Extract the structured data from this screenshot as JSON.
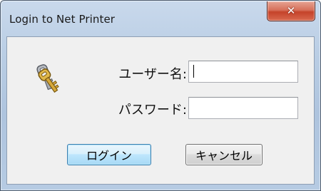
{
  "window": {
    "title": "Login to Net Printer",
    "close_icon": "close-icon"
  },
  "form": {
    "icon": "keys-icon",
    "username_label": "ユーザー名:",
    "username_value": "",
    "password_label": "パスワード:",
    "password_value": ""
  },
  "buttons": {
    "login_label": "ログイン",
    "cancel_label": "キャンセル"
  },
  "colors": {
    "titlebar": "#b9cde4",
    "close_button": "#c5432a",
    "dialog_body": "#f0f0f0",
    "default_button_border": "#3c7fb1"
  }
}
